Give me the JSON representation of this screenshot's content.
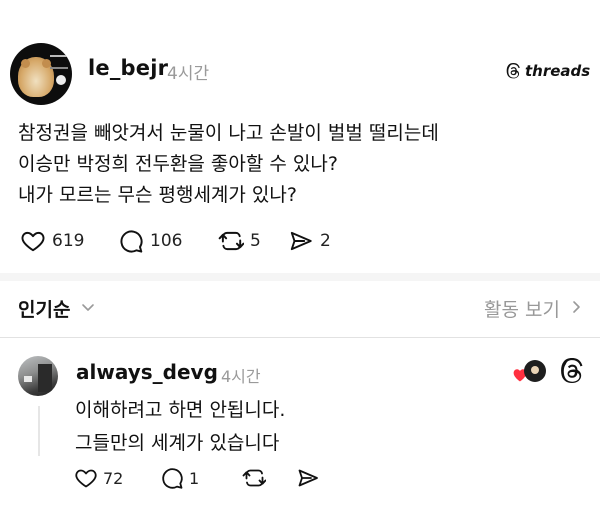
{
  "post": {
    "username": "le_bejr",
    "time": "4시간",
    "brand": "threads",
    "text_lines": [
      "참정권을 빼앗겨서 눈물이 나고 손발이 벌벌 떨리는데",
      "이승만 박정희 전두환을 좋아할 수 있나?",
      "내가 모르는 무슨 평행세계가 있나?"
    ],
    "likes": "619",
    "comments": "106",
    "reposts": "5",
    "shares": "2"
  },
  "sort": {
    "label": "인기순",
    "activity": "활동 보기"
  },
  "reply": {
    "username": "always_devg",
    "time": "4시간",
    "text_lines": [
      "이해하려고 하면 안됩니다.",
      "그들만의 세계가 있습니다"
    ],
    "likes": "72",
    "comments": "1"
  },
  "colors": {
    "text": "#111111",
    "muted": "#9a9a9a",
    "heart_red": "#ff3040"
  },
  "icons": [
    "threads-logo-icon",
    "heart-icon",
    "comment-icon",
    "repost-icon",
    "share-icon",
    "chevron-down-icon",
    "chevron-right-icon"
  ]
}
